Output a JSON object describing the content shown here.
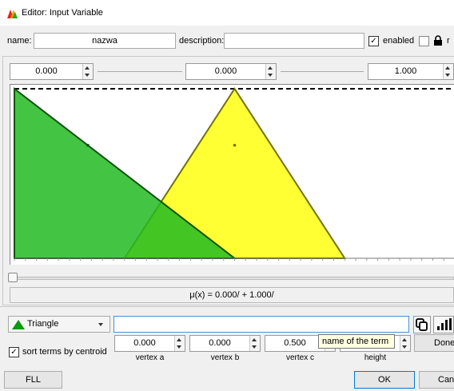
{
  "window": {
    "title": "Editor: Input Variable"
  },
  "header": {
    "name_label": "name:",
    "name_value": "nazwa",
    "description_label": "description:",
    "description_value": "",
    "enabled_label": "enabled",
    "enabled_checked": "✓",
    "lock_label": "r"
  },
  "range": {
    "minimum": "0.000",
    "middle": "0.000",
    "maximum": "1.000"
  },
  "terms": [
    {
      "shape": "Triangle",
      "vertex_a": 0.0,
      "vertex_b": 0.0,
      "vertex_c": 0.5,
      "height": 1.0,
      "color": "#22bb22",
      "selected": true
    },
    {
      "shape": "Triangle",
      "vertex_a": 0.25,
      "vertex_b": 0.5,
      "vertex_c": 0.75,
      "height": 1.0,
      "color": "#ffff00",
      "selected": false
    }
  ],
  "plot": {
    "x_min": 0.0,
    "x_max": 1.0,
    "y_min": 0.0,
    "y_max": 1.0
  },
  "slider": {
    "value": 0.0
  },
  "formula": "μ(x) = 0.000/ + 1.000/",
  "term_editor": {
    "shape_label": "Triangle",
    "name_value": "",
    "vertex_a_value": "0.000",
    "vertex_b_value": "0.000",
    "vertex_c_value": "0.500",
    "height_value": "",
    "vertex_a_label": "vertex a",
    "vertex_b_label": "vertex b",
    "vertex_c_label": "vertex c",
    "height_label": "height",
    "tooltip": "name of the term",
    "sort_label": "sort terms by centroid",
    "sort_checked": "✓",
    "done_label": "Done"
  },
  "footer": {
    "fll_label": "FLL",
    "ok_label": "OK",
    "cancel_label": "Cancel"
  }
}
